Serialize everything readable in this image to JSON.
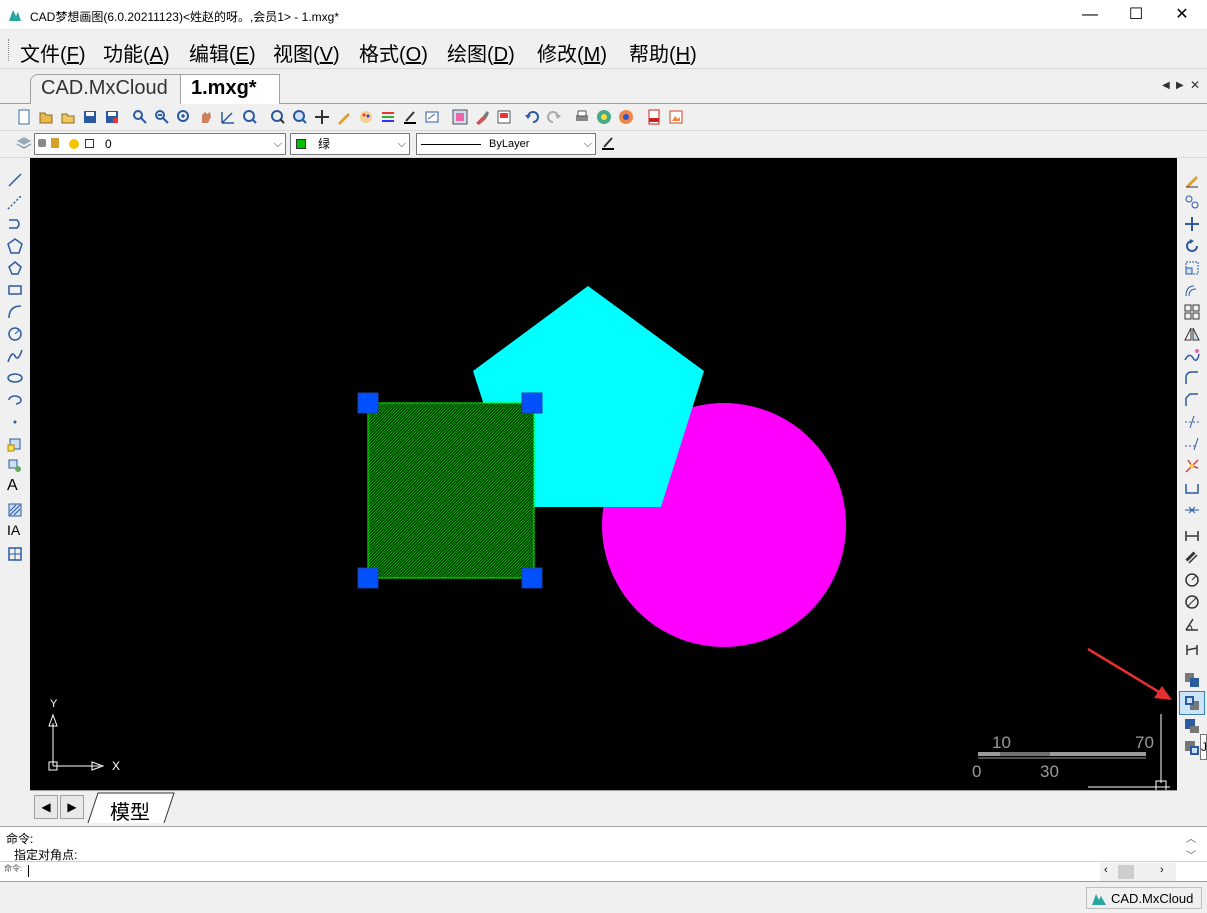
{
  "window": {
    "title": "CAD梦想画图(6.0.20211123)<姓赵的呀。,会员1> - 1.mxg*",
    "minimize": "—",
    "maximize": "☐",
    "close": "✕"
  },
  "menu": [
    {
      "label": "文件(",
      "key": "F",
      "end": ")"
    },
    {
      "label": "功能(",
      "key": "A",
      "end": ")"
    },
    {
      "label": "编辑(",
      "key": "E",
      "end": ")"
    },
    {
      "label": "视图(",
      "key": "V",
      "end": ")"
    },
    {
      "label": "格式(",
      "key": "O",
      "end": ")"
    },
    {
      "label": "绘图(",
      "key": "D",
      "end": ")"
    },
    {
      "label": "修改(",
      "key": "M",
      "end": ")"
    },
    {
      "label": "帮助(",
      "key": "H",
      "end": ")"
    }
  ],
  "tabs": {
    "cad": "CAD.MxCloud",
    "file": "1.mxg*"
  },
  "layer_combo": {
    "value": "0"
  },
  "color_combo": {
    "value": "绿",
    "swatch": "#00c000"
  },
  "linetype_combo": {
    "value": "ByLayer"
  },
  "scale_bar": {
    "top_left": "10",
    "top_right": "70",
    "bottom_left": "0",
    "bottom_mid": "30"
  },
  "ucs": {
    "x": "X",
    "y": "Y"
  },
  "model_tab": "模型",
  "command": {
    "line1": "命令:",
    "line2": "指定对角点:",
    "prompt": "命令:"
  },
  "status": {
    "brand": "CAD.MxCloud"
  },
  "colors": {
    "pentagon": "#00ffff",
    "circle": "#ff00ff",
    "hatch": "#00a000",
    "grip": "#0050ff",
    "arrow": "#e53030"
  },
  "tooltip_char": "J"
}
